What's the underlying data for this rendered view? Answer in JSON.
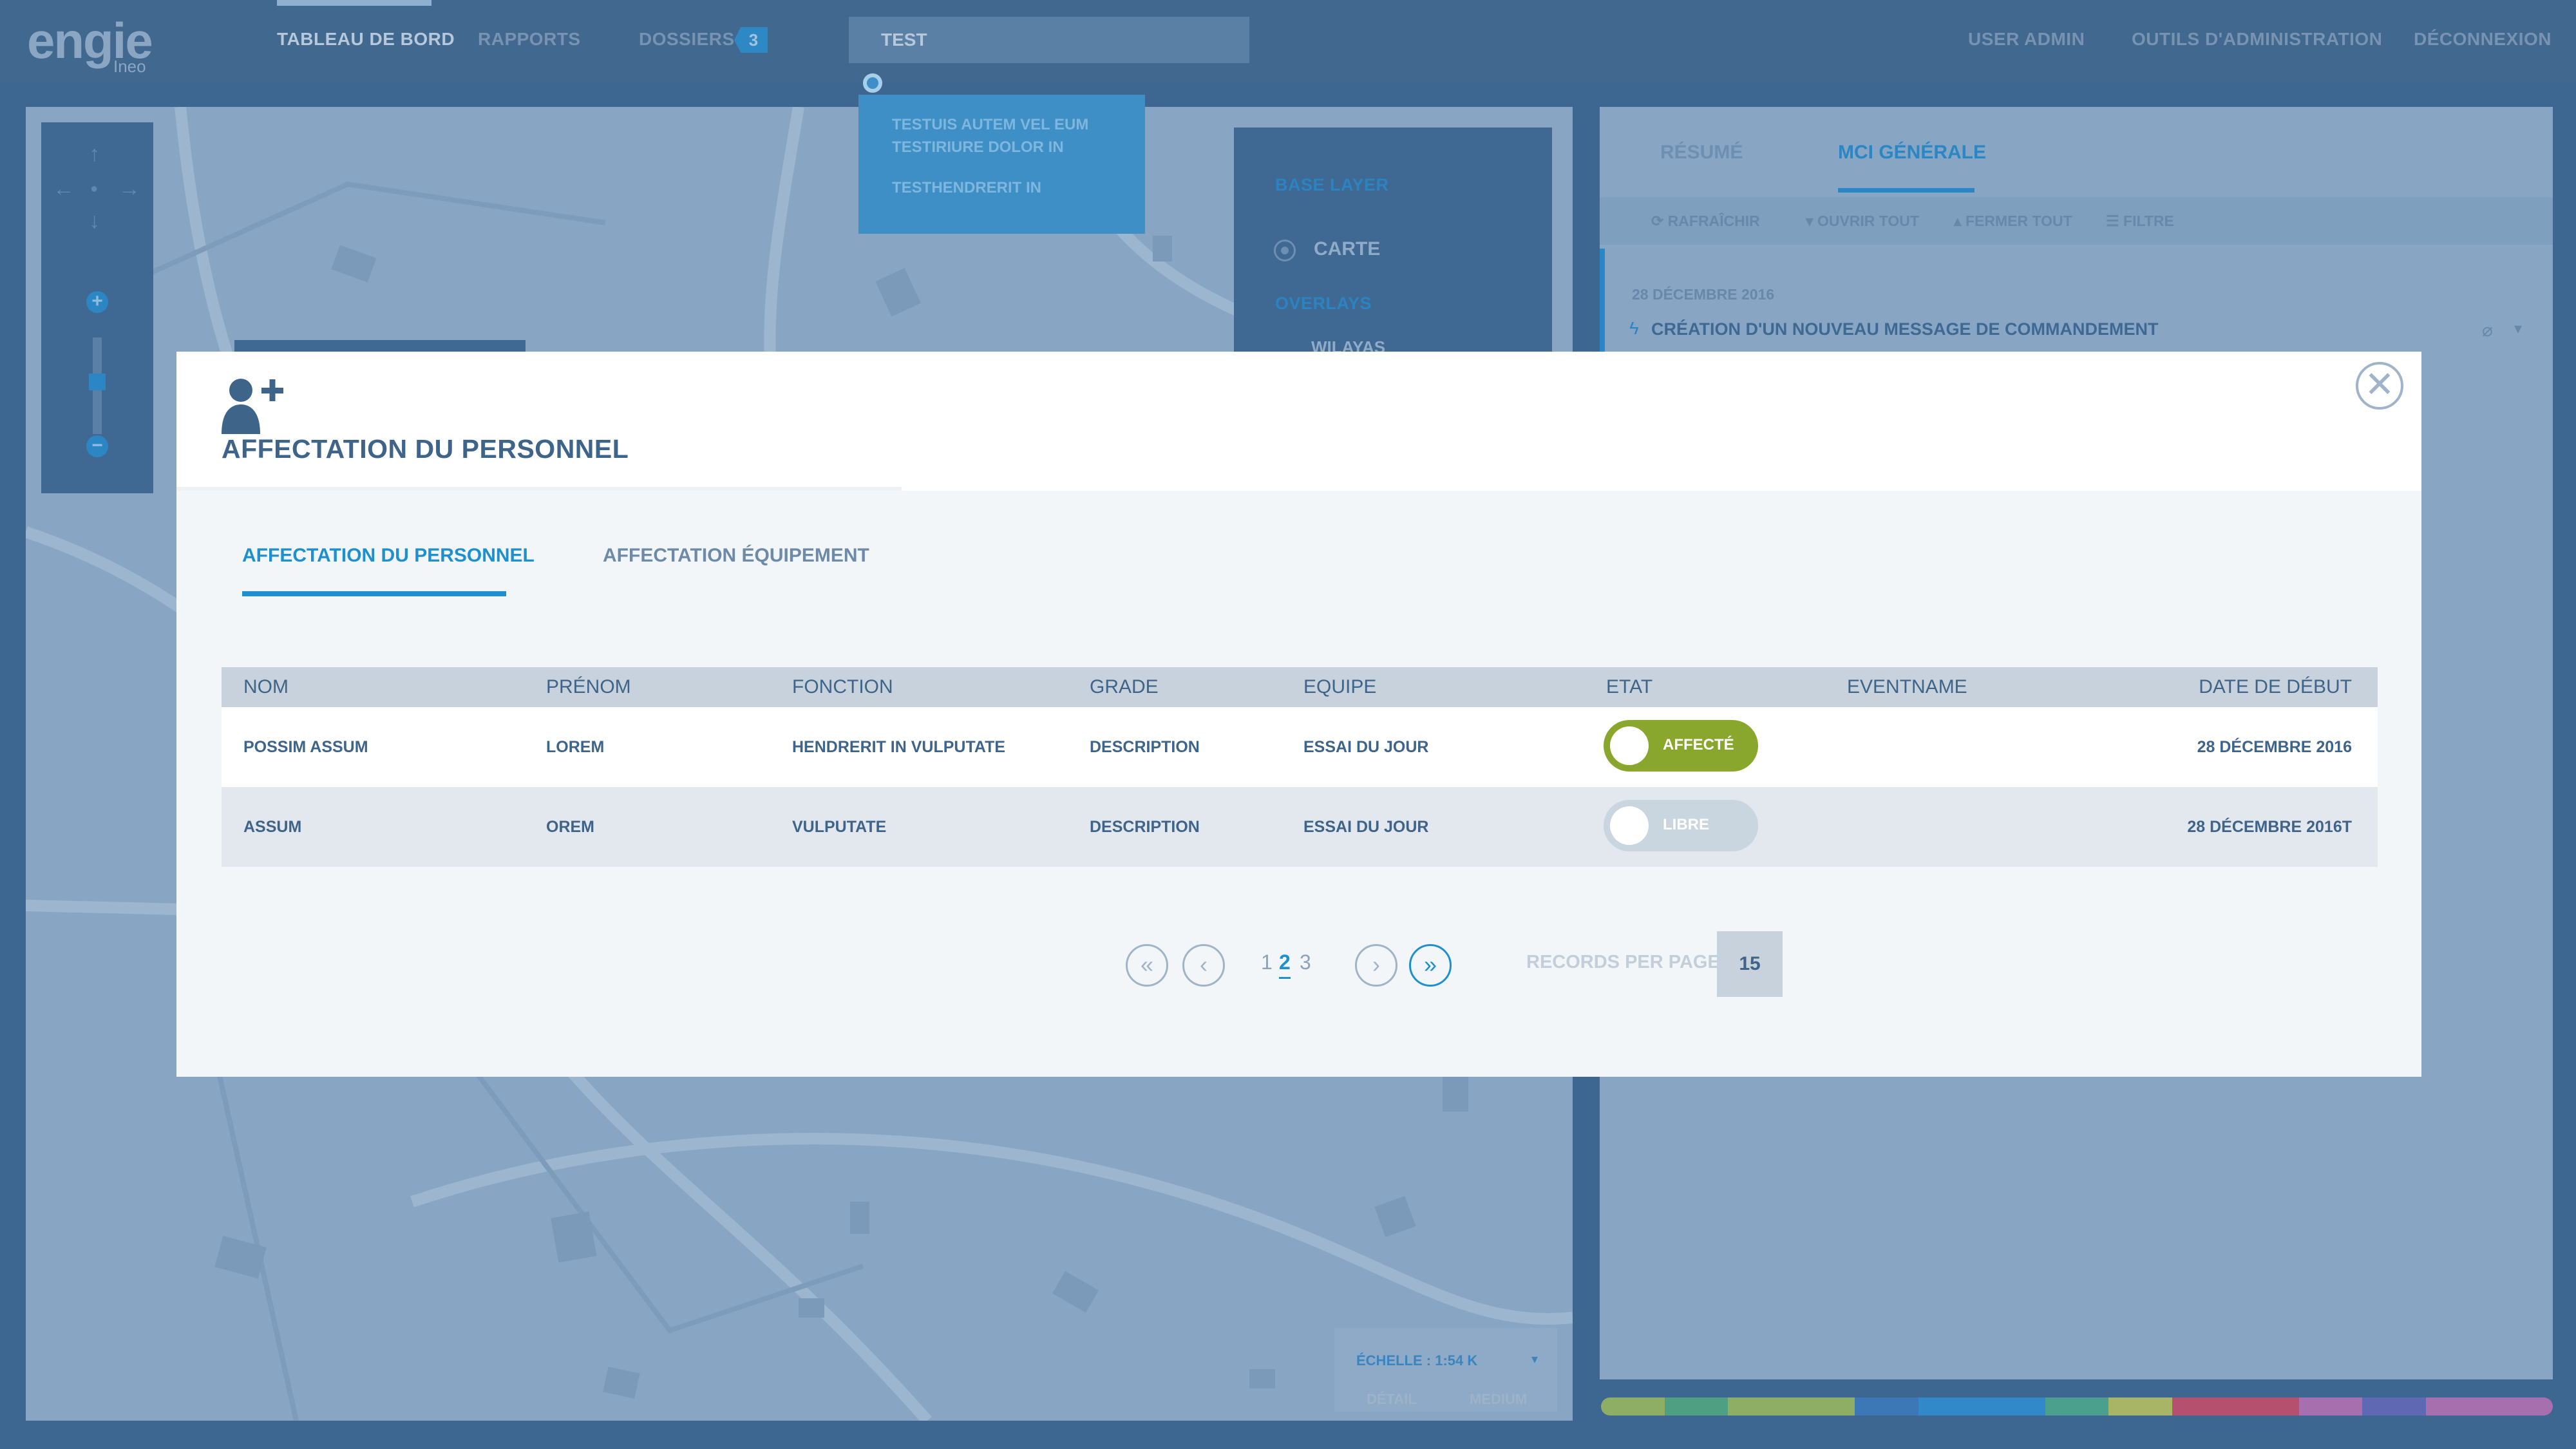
{
  "navbar": {
    "logo_main": "engie",
    "logo_sub": "Ineo",
    "items": [
      {
        "label": "TABLEAU DE BORD"
      },
      {
        "label": "RAPPORTS"
      },
      {
        "label": "DOSSIERS"
      }
    ],
    "dossiers_badge": "3",
    "search_value": "TEST",
    "search_results": [
      "TESTUIS AUTEM VEL EUM",
      "TESTIRIURE DOLOR IN",
      "TESTHENDRERIT IN"
    ],
    "right_items": [
      {
        "label": "USER ADMIN"
      },
      {
        "label": "OUTILS D'ADMINISTRATION"
      },
      {
        "label": "DÉCONNEXION"
      }
    ]
  },
  "map": {
    "base_layer_title": "BASE LAYER",
    "base_layer_option": "CARTE",
    "overlays_title": "OVERLAYS",
    "overlay_item": "WILAYAS",
    "scale_label": "ÉCHELLE : 1:54 K",
    "scale_sub_left": "DÉTAIL",
    "scale_sub_right": "MEDIUM"
  },
  "right_panel": {
    "tabs": [
      {
        "label": "RÉSUMÉ"
      },
      {
        "label": "MCI GÉNÉRALE"
      }
    ],
    "tools": [
      {
        "label": "RAFRAÎCHIR"
      },
      {
        "label": "OUVRIR TOUT"
      },
      {
        "label": "FERMER TOUT"
      },
      {
        "label": "FILTRE"
      }
    ],
    "item_date": "28 DÉCEMBRE 2016",
    "item_message": "CRÉATION D'UN NOUVEAU MESSAGE DE COMMANDEMENT"
  },
  "modal": {
    "title": "AFFECTATION DU PERSONNEL",
    "tabs": [
      {
        "label": "AFFECTATION DU PERSONNEL"
      },
      {
        "label": "AFFECTATION ÉQUIPEMENT"
      }
    ],
    "columns": [
      "NOM",
      "PRÉNOM",
      "FONCTION",
      "GRADE",
      "EQUIPE",
      "ETAT",
      "EVENTNAME",
      "DATE DE DÉBUT"
    ],
    "rows": [
      {
        "nom": "POSSIM ASSUM",
        "prenom": "LOREM",
        "fonction": "HENDRERIT IN VULPUTATE",
        "grade": "DESCRIPTION",
        "equipe": "ESSAI DU JOUR",
        "etat": "AFFECTÉ",
        "eventname": "",
        "date": "28 DÉCEMBRE 2016"
      },
      {
        "nom": "ASSUM",
        "prenom": "OREM",
        "fonction": "VULPUTATE",
        "grade": "DESCRIPTION",
        "equipe": "ESSAI DU JOUR",
        "etat": "LIBRE",
        "eventname": "",
        "date": "28 DÉCEMBRE 2016T"
      }
    ],
    "pagination": {
      "first": "«",
      "prev": "‹",
      "pages": [
        "1",
        "2",
        "3"
      ],
      "current_page": "2",
      "next": "›",
      "last": "»",
      "records_label": "RECORDS PER PAGE",
      "records_value": "15"
    },
    "close_symbol": "✕"
  },
  "colors": {
    "accent": "#1e8fcf",
    "affecte": "#8aa72d",
    "libre": "#c9d5df"
  },
  "icons": [
    "add-user-icon",
    "close-icon",
    "refresh-icon",
    "filter-icon",
    "bolt-icon",
    "attachment-icon",
    "chevron-down-icon"
  ]
}
